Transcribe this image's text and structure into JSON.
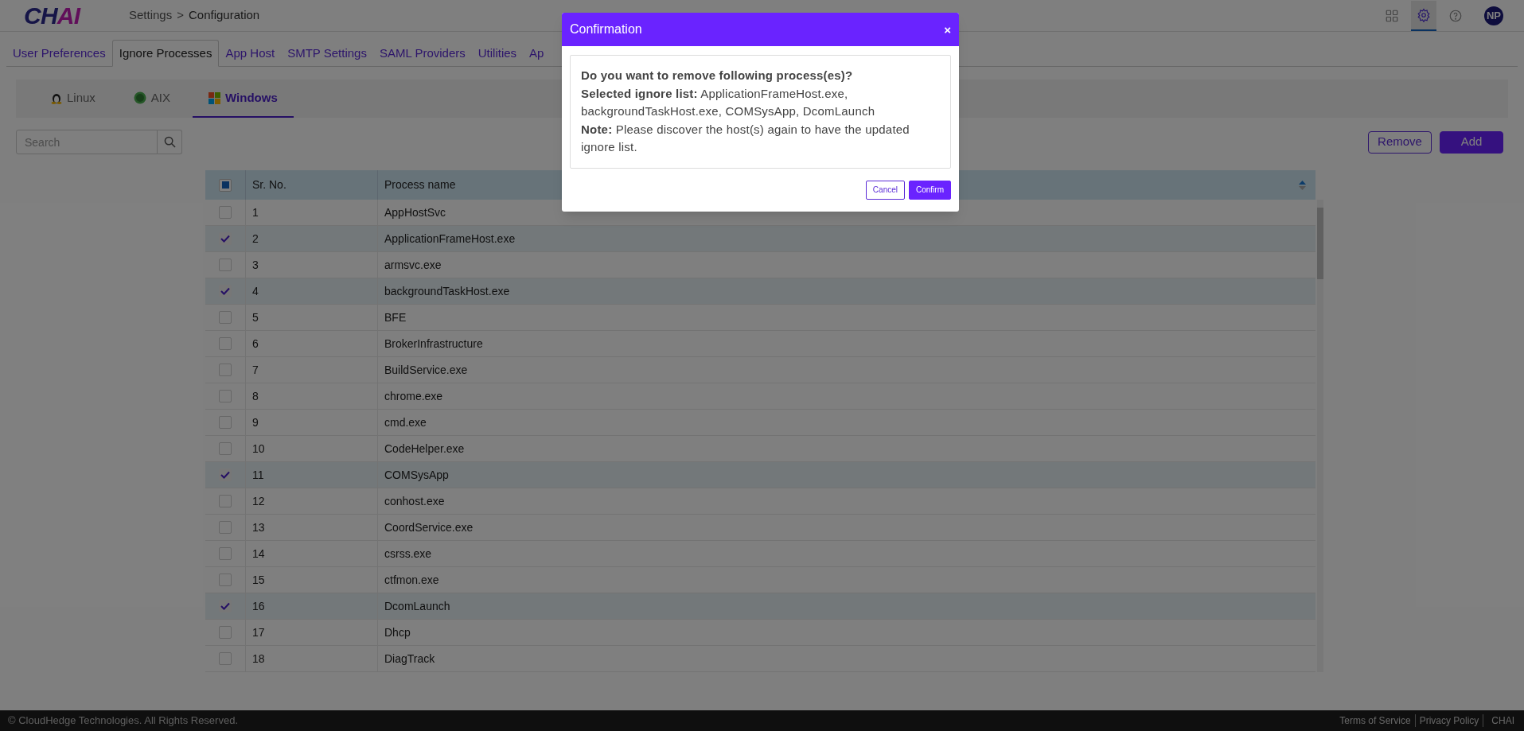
{
  "header": {
    "logo": "CHAI",
    "breadcrumb": [
      "Settings",
      "Configuration"
    ],
    "breadcrumb_separator": ">",
    "toolbar_icons": [
      {
        "kind": "grid",
        "selected": false
      },
      {
        "kind": "settings",
        "selected": true
      },
      {
        "kind": "help",
        "selected": false
      }
    ],
    "avatar": "NP"
  },
  "tabs": [
    {
      "label": "User Preferences",
      "selected": false
    },
    {
      "label": "Ignore Processes",
      "selected": true
    },
    {
      "label": "App Host",
      "selected": false
    },
    {
      "label": "SMTP Settings",
      "selected": false
    },
    {
      "label": "SAML Providers",
      "selected": false
    },
    {
      "label": "Utilities",
      "selected": false
    },
    {
      "label": "Ap",
      "selected": false
    }
  ],
  "os_tabs": [
    {
      "label": "Linux",
      "kind": "linux",
      "selected": false
    },
    {
      "label": "AIX",
      "kind": "aix",
      "selected": false
    },
    {
      "label": "Windows",
      "kind": "windows",
      "selected": true
    }
  ],
  "search": {
    "placeholder": "Search"
  },
  "actions": [
    {
      "label": "Remove",
      "kind": "outline"
    },
    {
      "label": "Add",
      "kind": "primary"
    }
  ],
  "table": {
    "select_all_indeterminate": true,
    "columns": [
      "Sr. No.",
      "Process name"
    ],
    "rows": [
      {
        "no": "1",
        "name": "AppHostSvc",
        "checked": false
      },
      {
        "no": "2",
        "name": "ApplicationFrameHost.exe",
        "checked": true
      },
      {
        "no": "3",
        "name": "armsvc.exe",
        "checked": false
      },
      {
        "no": "4",
        "name": "backgroundTaskHost.exe",
        "checked": true
      },
      {
        "no": "5",
        "name": "BFE",
        "checked": false
      },
      {
        "no": "6",
        "name": "BrokerInfrastructure",
        "checked": false
      },
      {
        "no": "7",
        "name": "BuildService.exe",
        "checked": false
      },
      {
        "no": "8",
        "name": "chrome.exe",
        "checked": false
      },
      {
        "no": "9",
        "name": "cmd.exe",
        "checked": false
      },
      {
        "no": "10",
        "name": "CodeHelper.exe",
        "checked": false
      },
      {
        "no": "11",
        "name": "COMSysApp",
        "checked": true
      },
      {
        "no": "12",
        "name": "conhost.exe",
        "checked": false
      },
      {
        "no": "13",
        "name": "CoordService.exe",
        "checked": false
      },
      {
        "no": "14",
        "name": "csrss.exe",
        "checked": false
      },
      {
        "no": "15",
        "name": "ctfmon.exe",
        "checked": false
      },
      {
        "no": "16",
        "name": "DcomLaunch",
        "checked": true
      },
      {
        "no": "17",
        "name": "Dhcp",
        "checked": false
      },
      {
        "no": "18",
        "name": "DiagTrack",
        "checked": false
      }
    ]
  },
  "dialog": {
    "title": "Confirmation",
    "close": "×",
    "question": "Do you want to remove following process(es)?",
    "lines": [
      "**Selected ignore list:** ApplicationFrameHost.exe, backgroundTaskHost.exe, COMSysApp, DcomLaunch",
      "**Note:** Please discover the host(s) again to have the updated ignore list."
    ],
    "buttons": [
      {
        "label": "Cancel",
        "kind": "outline"
      },
      {
        "label": "Confirm",
        "kind": "primary"
      }
    ]
  },
  "footer": {
    "copyright": "© CloudHedge Technologies. All Rights Reserved.",
    "links": [
      "Terms of Service",
      "Privacy Policy"
    ],
    "brand": "CHAI"
  }
}
